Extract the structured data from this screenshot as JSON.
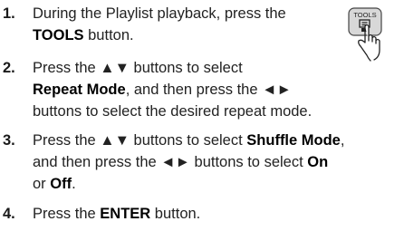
{
  "steps": [
    {
      "number": "1.",
      "lines": [
        [
          {
            "t": "During the Playlist playback, press the",
            "b": false
          }
        ],
        [
          {
            "t": "TOOLS",
            "b": true
          },
          {
            "t": " button.",
            "b": false
          }
        ]
      ]
    },
    {
      "number": "2.",
      "lines": [
        [
          {
            "t": "Press the ▲▼ buttons to select",
            "b": false
          }
        ],
        [
          {
            "t": "Repeat Mode",
            "b": true
          },
          {
            "t": ", and then press the ◄►",
            "b": false
          }
        ],
        [
          {
            "t": "buttons to select the desired repeat mode.",
            "b": false
          }
        ]
      ]
    },
    {
      "number": "3.",
      "lines": [
        [
          {
            "t": "Press the ▲▼ buttons to select ",
            "b": false
          },
          {
            "t": "Shuffle Mode",
            "b": true
          },
          {
            "t": ",",
            "b": false
          }
        ],
        [
          {
            "t": "and then press the ◄► buttons to select ",
            "b": false
          },
          {
            "t": "On",
            "b": true
          }
        ],
        [
          {
            "t": "or ",
            "b": false
          },
          {
            "t": "Off",
            "b": true
          },
          {
            "t": ".",
            "b": false
          }
        ]
      ]
    },
    {
      "number": "4.",
      "lines": [
        [
          {
            "t": "Press the ",
            "b": false
          },
          {
            "t": "ENTER",
            "b": true
          },
          {
            "t": " button.",
            "b": false
          }
        ]
      ]
    }
  ],
  "illustration": {
    "button_label": "TOOLS",
    "icon": "remote-tools-button-press-icon"
  }
}
